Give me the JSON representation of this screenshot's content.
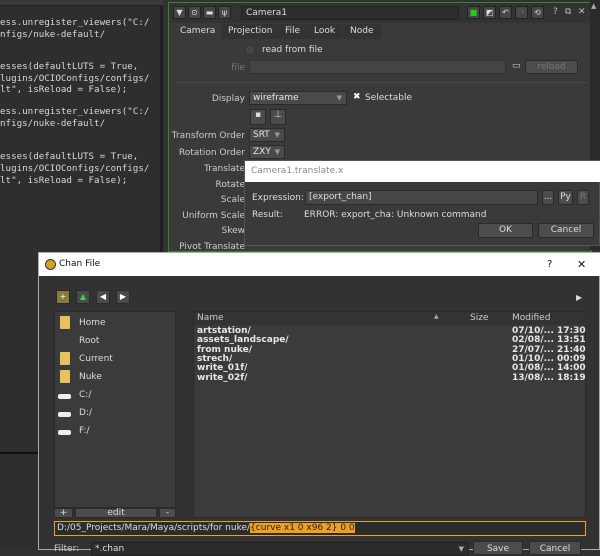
{
  "script_editor": {
    "lines": [
      "ess.unregister_viewers(\"C:/",
      "nfigs/nuke-default/",
      "esses(defaultLUTS = True,",
      "lugins/OCIOConfigs/configs/",
      "lt\", isReload = False);",
      "ess.unregister_viewers(\"C:/",
      "nfigs/nuke-default/",
      "esses(defaultLUTS = True,",
      "lugins/OCIOConfigs/configs/",
      "lt\", isReload = False);"
    ]
  },
  "properties": {
    "node_name": "Camera1",
    "tabs": [
      "Camera",
      "Projection",
      "File",
      "Look",
      "Node"
    ],
    "read_from_file": "read from file",
    "file_label": "file",
    "reload": "reload",
    "display_label": "Display",
    "display_value": "wireframe",
    "selectable": "Selectable",
    "transform_order_label": "Transform Order",
    "transform_order": "SRT",
    "rotation_order_label": "Rotation Order",
    "rotation_order": "ZXY",
    "labels": [
      "Translate",
      "Rotate",
      "Scale",
      "Uniform Scale",
      "Skew",
      "Pivot Translate"
    ],
    "header_buttons": [
      "?",
      "⧉",
      "✕"
    ]
  },
  "expression_dialog": {
    "title": "Camera1.translate.x",
    "expression_label": "Expression:",
    "expression": "[export_chan]",
    "more": "...",
    "py": "Py",
    "r": "R",
    "result_label": "Result:",
    "result": "ERROR: export_cha: Unknown command",
    "ok": "OK",
    "cancel": "Cancel"
  },
  "chan_dialog": {
    "title": "Chan File",
    "help": "?",
    "close": "✕",
    "sidebar": [
      "Home",
      "Root",
      "Current",
      "Nuke",
      "C:/",
      "D:/",
      "F:/"
    ],
    "sidebar_buttons": {
      "add": "+",
      "edit": "edit",
      "remove": "-"
    },
    "columns": [
      "Name",
      "Size",
      "Modified"
    ],
    "files": [
      {
        "name": "artstation/",
        "modified": "07/10/... 17:30"
      },
      {
        "name": "assets_landscape/",
        "modified": "02/08/... 13:51"
      },
      {
        "name": "from nuke/",
        "modified": "27/07/... 21:40"
      },
      {
        "name": "strech/",
        "modified": "01/10/... 00:09"
      },
      {
        "name": "write_01f/",
        "modified": "01/08/... 14:00"
      },
      {
        "name": "write_02f/",
        "modified": "13/08/... 18:19"
      }
    ],
    "path_prefix": "D:/05_Projects/Mara/Maya/scripts/for nuke/",
    "path_selected": "{curve x1 0 x96 2} 0 0",
    "filter_label": "Filter:",
    "filter_value": "*.chan",
    "save": "Save",
    "cancel": "Cancel"
  },
  "colors": {
    "accent_green": "#2c8a2c",
    "selection_orange": "#f0a020"
  }
}
